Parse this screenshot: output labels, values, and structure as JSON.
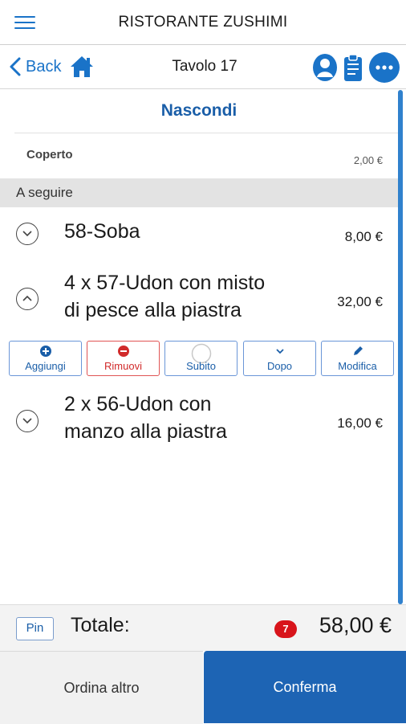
{
  "app": {
    "title": "RISTORANTE ZUSHIMI"
  },
  "nav": {
    "back_label": "Back",
    "table_title": "Tavolo 17",
    "icons": [
      "menu-icon",
      "chevron-left-icon",
      "home-icon",
      "user-icon",
      "clipboard-icon",
      "more-icon"
    ]
  },
  "order": {
    "hide_label": "Nascondi",
    "cover": {
      "label": "Coperto",
      "price": "2,00 €"
    },
    "section_title": "A seguire",
    "items": [
      {
        "name": "58-Soba",
        "price": "8,00 €",
        "expanded": false
      },
      {
        "name_line1": "4 x 57-Udon con misto",
        "name_line2": "di pesce alla piastra",
        "price": "32,00 €",
        "expanded": true
      },
      {
        "name_line1": "2 x 56-Udon con",
        "name_line2": "manzo alla piastra",
        "price": "16,00 €",
        "expanded": false
      }
    ],
    "actions": [
      "Aggiungi",
      "Rimuovi",
      "Subito",
      "Dopo",
      "Modifica"
    ]
  },
  "totals": {
    "pin_label": "Pin",
    "total_label": "Totale:",
    "count": "7",
    "amount": "58,00 €"
  },
  "footer": {
    "order_more_label": "Ordina altro",
    "confirm_label": "Conferma"
  },
  "colors": {
    "accent": "#1a73c8",
    "confirm_bg": "#1d64b4",
    "danger": "#d12a2a",
    "badge": "#d8141b",
    "section_bg": "#e3e3e3"
  }
}
